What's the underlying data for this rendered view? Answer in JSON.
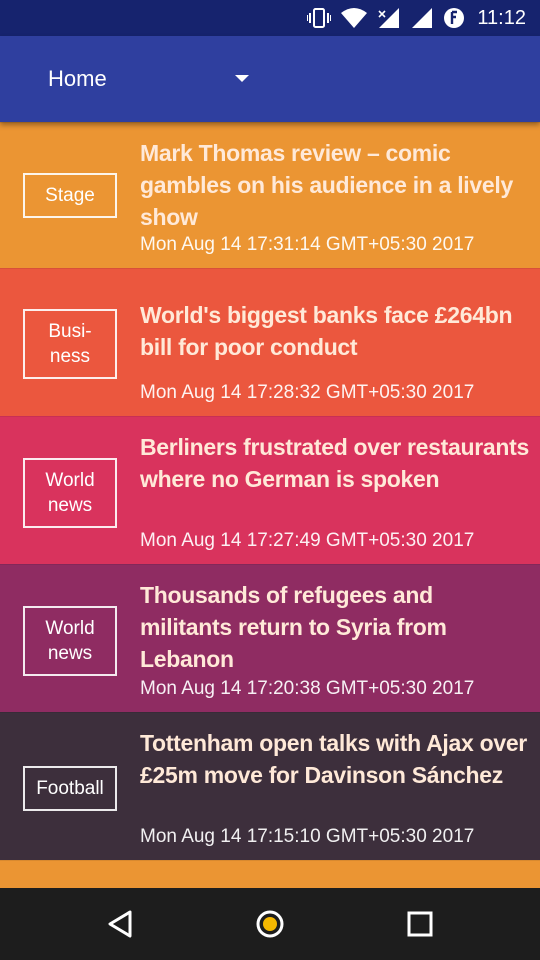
{
  "status_bar": {
    "time": "11:12",
    "icons": [
      "vibrate-icon",
      "wifi-icon",
      "signal-icon",
      "data-saver-icon"
    ]
  },
  "toolbar": {
    "spinner_label": "Home",
    "dropdown_icon": "caret-down-icon"
  },
  "articles": [
    {
      "section": "Stage",
      "title": "Mark Thomas review – comic gambles on his audience in a lively show",
      "date": "Mon Aug 14 17:31:14 GMT+05:30 2017",
      "color": "#eb9533"
    },
    {
      "section": "Busi-\nness",
      "title": "World's biggest banks face £264bn bill for poor conduct",
      "date": "Mon Aug 14 17:28:32 GMT+05:30 2017",
      "color": "#eb573e"
    },
    {
      "section": "World news",
      "title": "Berliners frustrated over restaurants where no German is spoken",
      "date": "Mon Aug 14 17:27:49 GMT+05:30 2017",
      "color": "#d9335d"
    },
    {
      "section": "World news",
      "title": "Thousands of refugees and militants return to Syria from Lebanon",
      "date": "Mon Aug 14 17:20:38 GMT+05:30 2017",
      "color": "#8f2c62"
    },
    {
      "section": "Football",
      "title": "Tottenham open talks with Ajax over £25m move for Davinson Sánchez",
      "date": "Mon Aug 14 17:15:10 GMT+05:30 2017",
      "color": "#3d2f3c"
    }
  ],
  "nav_bar": {
    "icons": [
      "back-icon",
      "home-icon",
      "recents-icon"
    ]
  },
  "colors": {
    "status_bar": "#16236e",
    "app_bar": "#2f3f9f",
    "partial_card": "#eb9533",
    "home_button_accent": "#f5b800"
  }
}
